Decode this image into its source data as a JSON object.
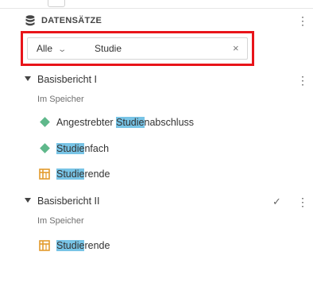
{
  "panel": {
    "title": "DATENSÄTZE",
    "menu_icon": "kebab-icon"
  },
  "search": {
    "scope": "Alle",
    "value": "Studie",
    "clear_icon": "close-icon"
  },
  "groups": [
    {
      "label": "Basisbericht I",
      "status": "Im Speicher",
      "items": [
        {
          "type": "dimension",
          "icon": "diamond-icon",
          "match": "Studie",
          "before": "Angestrebter ",
          "after": "nabschluss"
        },
        {
          "type": "dimension",
          "icon": "diamond-icon",
          "match": "Studie",
          "before": "",
          "after": "nfach"
        },
        {
          "type": "table",
          "icon": "table-icon",
          "match": "Studie",
          "before": "",
          "after": "rende"
        }
      ]
    },
    {
      "label": "Basisbericht II",
      "status": "Im Speicher",
      "checked": true,
      "items": [
        {
          "type": "table",
          "icon": "table-icon",
          "match": "Studie",
          "before": "",
          "after": "rende"
        }
      ]
    }
  ],
  "colors": {
    "highlight_border": "#e8141a",
    "match_background": "#78c4e6",
    "dimension_icon": "#5fb88b",
    "table_icon": "#e39b2d"
  }
}
